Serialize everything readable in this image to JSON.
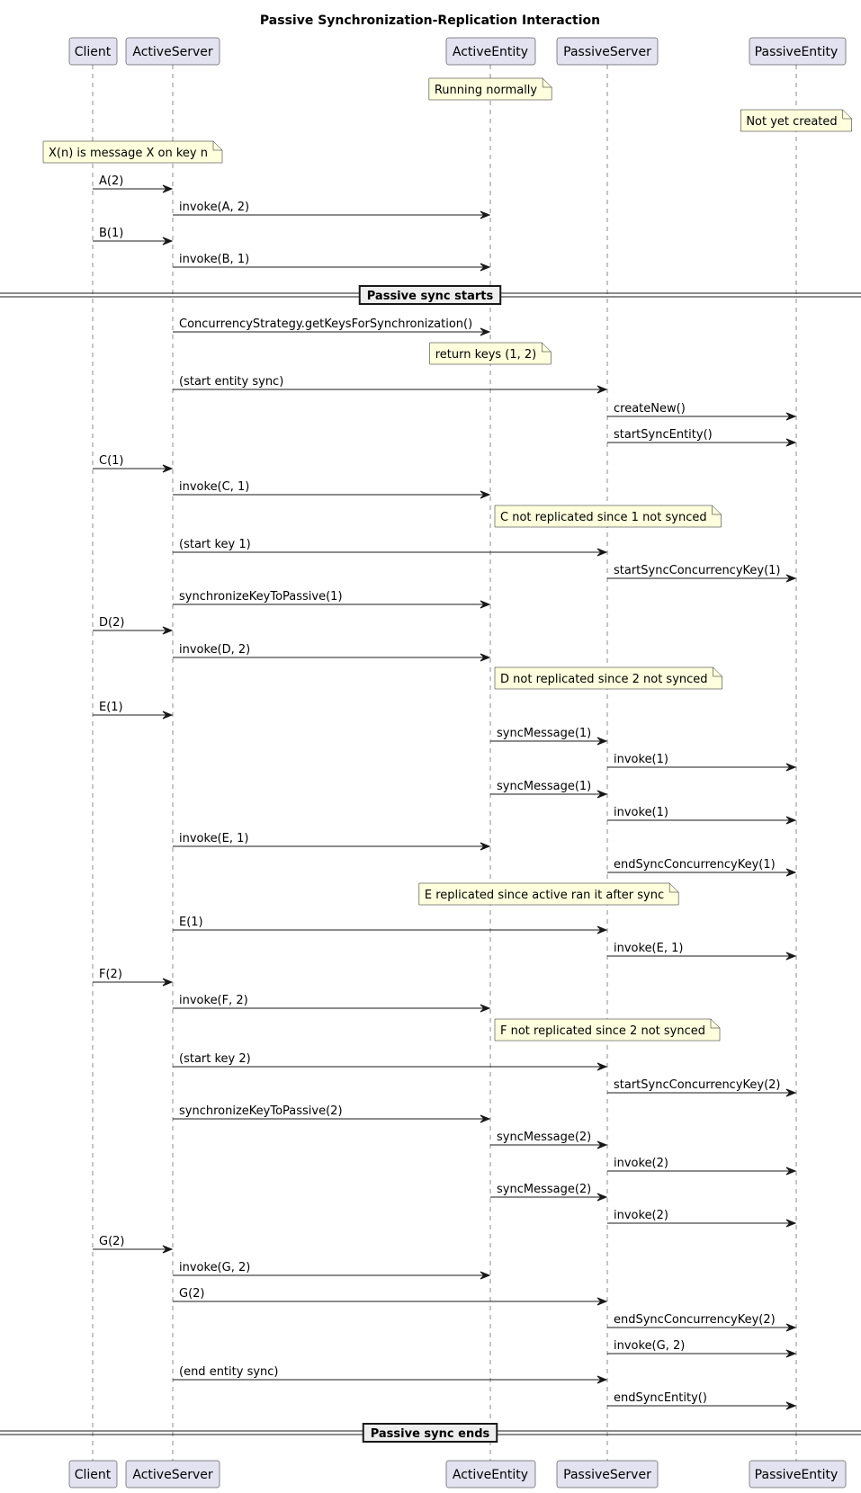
{
  "title": "Passive Synchronization-Replication Interaction",
  "colors": {
    "participant_fill": "#E2E2F0",
    "participant_stroke": "#181818",
    "note_fill": "#FEFFDD",
    "note_stroke": "#181818",
    "line": "#181818",
    "divider_fill": "#EEEEEE"
  },
  "participants": [
    {
      "id": "Client",
      "label": "Client"
    },
    {
      "id": "ActiveServer",
      "label": "ActiveServer"
    },
    {
      "id": "ActiveEntity",
      "label": "ActiveEntity"
    },
    {
      "id": "PassiveServer",
      "label": "PassiveServer"
    },
    {
      "id": "PassiveEntity",
      "label": "PassiveEntity"
    }
  ],
  "events": [
    {
      "type": "note",
      "over": "ActiveEntity",
      "text": "Running normally"
    },
    {
      "type": "note",
      "over": "PassiveEntity",
      "text": "Not yet created"
    },
    {
      "type": "note",
      "over": "Client",
      "span": "ActiveServer",
      "text": "X(n) is message X on key n"
    },
    {
      "type": "msg",
      "from": "Client",
      "to": "ActiveServer",
      "text": "A(2)"
    },
    {
      "type": "msg",
      "from": "ActiveServer",
      "to": "ActiveEntity",
      "text": "invoke(A, 2)"
    },
    {
      "type": "msg",
      "from": "Client",
      "to": "ActiveServer",
      "text": "B(1)"
    },
    {
      "type": "msg",
      "from": "ActiveServer",
      "to": "ActiveEntity",
      "text": "invoke(B, 1)"
    },
    {
      "type": "divider",
      "text": "Passive sync starts"
    },
    {
      "type": "msg",
      "from": "ActiveServer",
      "to": "ActiveEntity",
      "text": "ConcurrencyStrategy.getKeysForSynchronization()"
    },
    {
      "type": "note",
      "over": "ActiveEntity",
      "text": "return keys (1, 2)"
    },
    {
      "type": "msg",
      "from": "ActiveServer",
      "to": "PassiveServer",
      "text": "(start entity sync)"
    },
    {
      "type": "msg",
      "from": "PassiveServer",
      "to": "PassiveEntity",
      "text": "createNew()"
    },
    {
      "type": "msg",
      "from": "PassiveServer",
      "to": "PassiveEntity",
      "text": "startSyncEntity()"
    },
    {
      "type": "msg",
      "from": "Client",
      "to": "ActiveServer",
      "text": "C(1)"
    },
    {
      "type": "msg",
      "from": "ActiveServer",
      "to": "ActiveEntity",
      "text": "invoke(C, 1)"
    },
    {
      "type": "note",
      "right_of": "ActiveEntity",
      "text": "C not replicated since 1 not synced"
    },
    {
      "type": "msg",
      "from": "ActiveServer",
      "to": "PassiveServer",
      "text": "(start key 1)"
    },
    {
      "type": "msg",
      "from": "PassiveServer",
      "to": "PassiveEntity",
      "text": "startSyncConcurrencyKey(1)"
    },
    {
      "type": "msg",
      "from": "ActiveServer",
      "to": "ActiveEntity",
      "text": "synchronizeKeyToPassive(1)"
    },
    {
      "type": "msg",
      "from": "Client",
      "to": "ActiveServer",
      "text": "D(2)"
    },
    {
      "type": "msg",
      "from": "ActiveServer",
      "to": "ActiveEntity",
      "text": "invoke(D, 2)"
    },
    {
      "type": "note",
      "right_of": "ActiveEntity",
      "text": "D not replicated since 2 not synced"
    },
    {
      "type": "msg",
      "from": "Client",
      "to": "ActiveServer",
      "text": "E(1)"
    },
    {
      "type": "msg",
      "from": "ActiveEntity",
      "to": "PassiveServer",
      "text": "syncMessage(1)"
    },
    {
      "type": "msg",
      "from": "PassiveServer",
      "to": "PassiveEntity",
      "text": "invoke(1)"
    },
    {
      "type": "msg",
      "from": "ActiveEntity",
      "to": "PassiveServer",
      "text": "syncMessage(1)"
    },
    {
      "type": "msg",
      "from": "PassiveServer",
      "to": "PassiveEntity",
      "text": "invoke(1)"
    },
    {
      "type": "msg",
      "from": "ActiveServer",
      "to": "ActiveEntity",
      "text": "invoke(E, 1)"
    },
    {
      "type": "msg",
      "from": "PassiveServer",
      "to": "PassiveEntity",
      "text": "endSyncConcurrencyKey(1)"
    },
    {
      "type": "note",
      "over": "ActiveEntity",
      "span": "PassiveServer",
      "text": "E replicated since active ran it after sync"
    },
    {
      "type": "msg",
      "from": "ActiveServer",
      "to": "PassiveServer",
      "text": "E(1)"
    },
    {
      "type": "msg",
      "from": "PassiveServer",
      "to": "PassiveEntity",
      "text": "invoke(E, 1)"
    },
    {
      "type": "msg",
      "from": "Client",
      "to": "ActiveServer",
      "text": "F(2)"
    },
    {
      "type": "msg",
      "from": "ActiveServer",
      "to": "ActiveEntity",
      "text": "invoke(F, 2)"
    },
    {
      "type": "note",
      "right_of": "ActiveEntity",
      "text": "F not replicated since 2 not synced"
    },
    {
      "type": "msg",
      "from": "ActiveServer",
      "to": "PassiveServer",
      "text": "(start key 2)"
    },
    {
      "type": "msg",
      "from": "PassiveServer",
      "to": "PassiveEntity",
      "text": "startSyncConcurrencyKey(2)"
    },
    {
      "type": "msg",
      "from": "ActiveServer",
      "to": "ActiveEntity",
      "text": "synchronizeKeyToPassive(2)"
    },
    {
      "type": "msg",
      "from": "ActiveEntity",
      "to": "PassiveServer",
      "text": "syncMessage(2)"
    },
    {
      "type": "msg",
      "from": "PassiveServer",
      "to": "PassiveEntity",
      "text": "invoke(2)"
    },
    {
      "type": "msg",
      "from": "ActiveEntity",
      "to": "PassiveServer",
      "text": "syncMessage(2)"
    },
    {
      "type": "msg",
      "from": "PassiveServer",
      "to": "PassiveEntity",
      "text": "invoke(2)"
    },
    {
      "type": "msg",
      "from": "Client",
      "to": "ActiveServer",
      "text": "G(2)"
    },
    {
      "type": "msg",
      "from": "ActiveServer",
      "to": "ActiveEntity",
      "text": "invoke(G, 2)"
    },
    {
      "type": "msg",
      "from": "ActiveServer",
      "to": "PassiveServer",
      "text": "G(2)"
    },
    {
      "type": "msg",
      "from": "PassiveServer",
      "to": "PassiveEntity",
      "text": "endSyncConcurrencyKey(2)"
    },
    {
      "type": "msg",
      "from": "PassiveServer",
      "to": "PassiveEntity",
      "text": "invoke(G, 2)"
    },
    {
      "type": "msg",
      "from": "ActiveServer",
      "to": "PassiveServer",
      "text": "(end entity sync)"
    },
    {
      "type": "msg",
      "from": "PassiveServer",
      "to": "PassiveEntity",
      "text": "endSyncEntity()"
    },
    {
      "type": "divider",
      "text": "Passive sync ends"
    }
  ]
}
